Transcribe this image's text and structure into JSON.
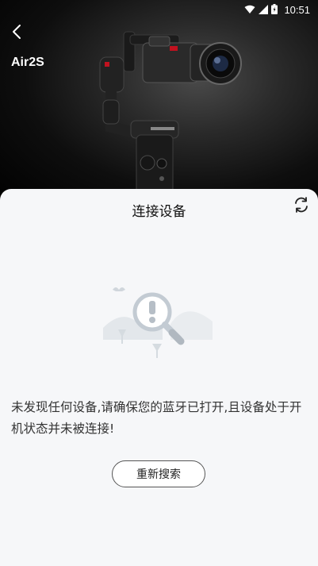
{
  "status_bar": {
    "time": "10:51",
    "icons": [
      "wifi-icon",
      "cellular-signal-icon",
      "battery-icon"
    ]
  },
  "header": {
    "back_icon": "chevron-left-icon",
    "device_name": "Air2S"
  },
  "sheet": {
    "title": "连接设备",
    "refresh_icon": "refresh-icon",
    "illustration": "search-not-found-illustration",
    "message": "未发现任何设备,请确保您的蓝牙已打开,且设备处于开机状态并未被连接!",
    "rescan_label": "重新搜索"
  },
  "colors": {
    "sheet_background": "#f6f7f9",
    "hero_background": "#000000",
    "text_primary": "#111111",
    "illustration_gray": "#c3cbd3"
  }
}
